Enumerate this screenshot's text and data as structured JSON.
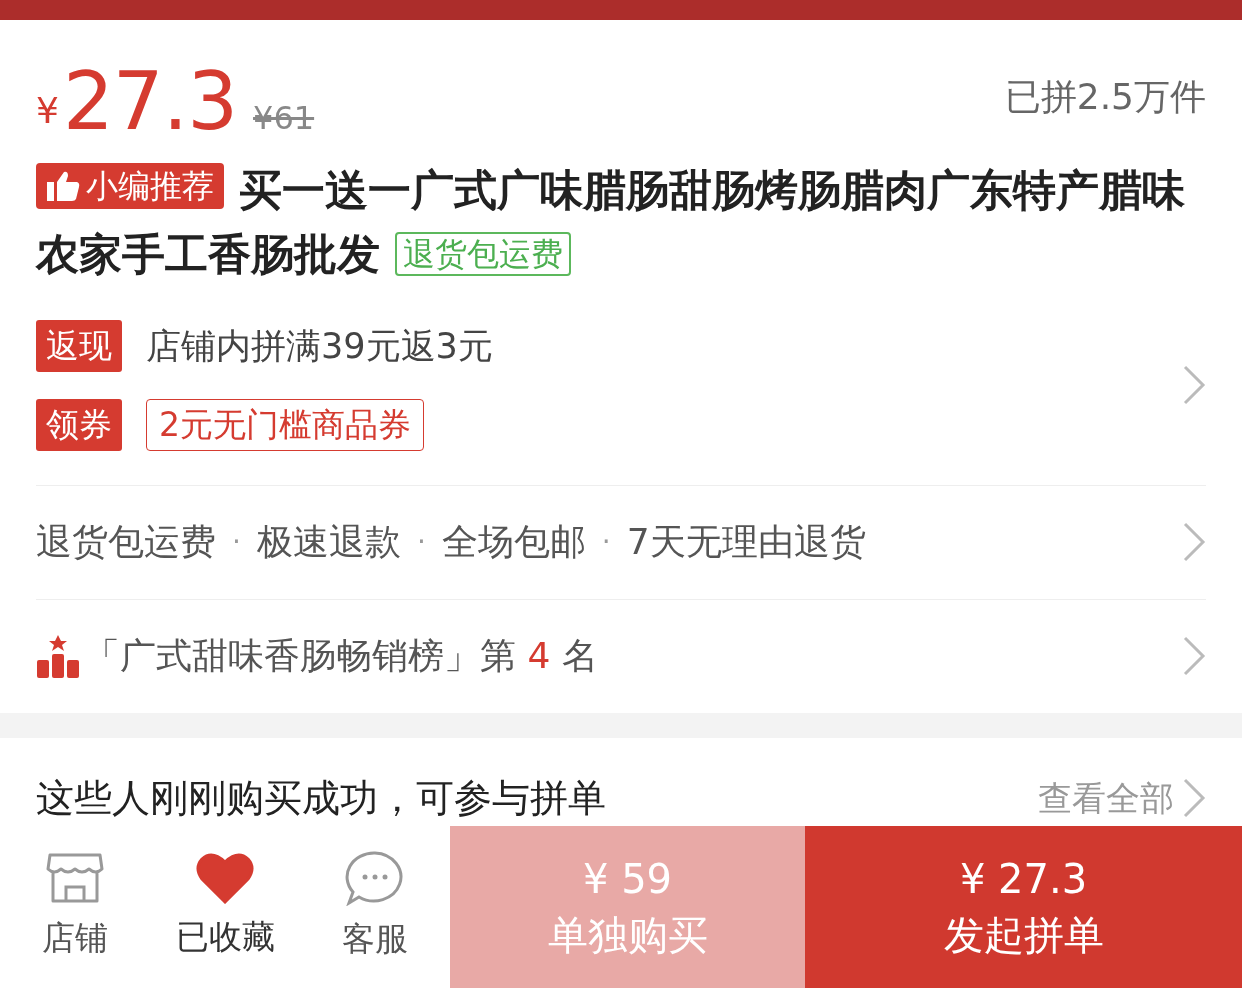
{
  "price": {
    "currency": "¥",
    "amount": "27.3",
    "original": "¥61"
  },
  "sold": "已拼2.5万件",
  "title": {
    "badge": "小编推荐",
    "text": "买一送一广式广味腊肠甜肠烤肠腊肉广东特产腊味农家手工香肠批发",
    "tag": "退货包运费"
  },
  "promos": [
    {
      "kind": "plain",
      "label": "返现",
      "text": "店铺内拼满39元返3元"
    },
    {
      "kind": "coupon",
      "label": "领券",
      "text": "2元无门槛商品券"
    }
  ],
  "services": {
    "separator": "·",
    "items": [
      "退货包运费",
      "极速退款",
      "全场包邮",
      "7天无理由退货"
    ]
  },
  "ranking": {
    "prefix": "「广式甜味香肠畅销榜」第",
    "rank": "4",
    "suffix": "名"
  },
  "recent": {
    "title": "这些人刚刚购买成功，可参与拼单",
    "link": "查看全部"
  },
  "bottom_bar": {
    "tabs": [
      {
        "kind": "store",
        "label": "店铺",
        "on": false
      },
      {
        "kind": "heart",
        "label": "已收藏",
        "on": true
      },
      {
        "kind": "chat",
        "label": "客服",
        "on": false
      }
    ],
    "buttons": [
      {
        "kind": "solo",
        "price": "¥ 59",
        "label": "单独购买"
      },
      {
        "kind": "group",
        "price": "¥ 27.3",
        "label": "发起拼单"
      }
    ]
  }
}
